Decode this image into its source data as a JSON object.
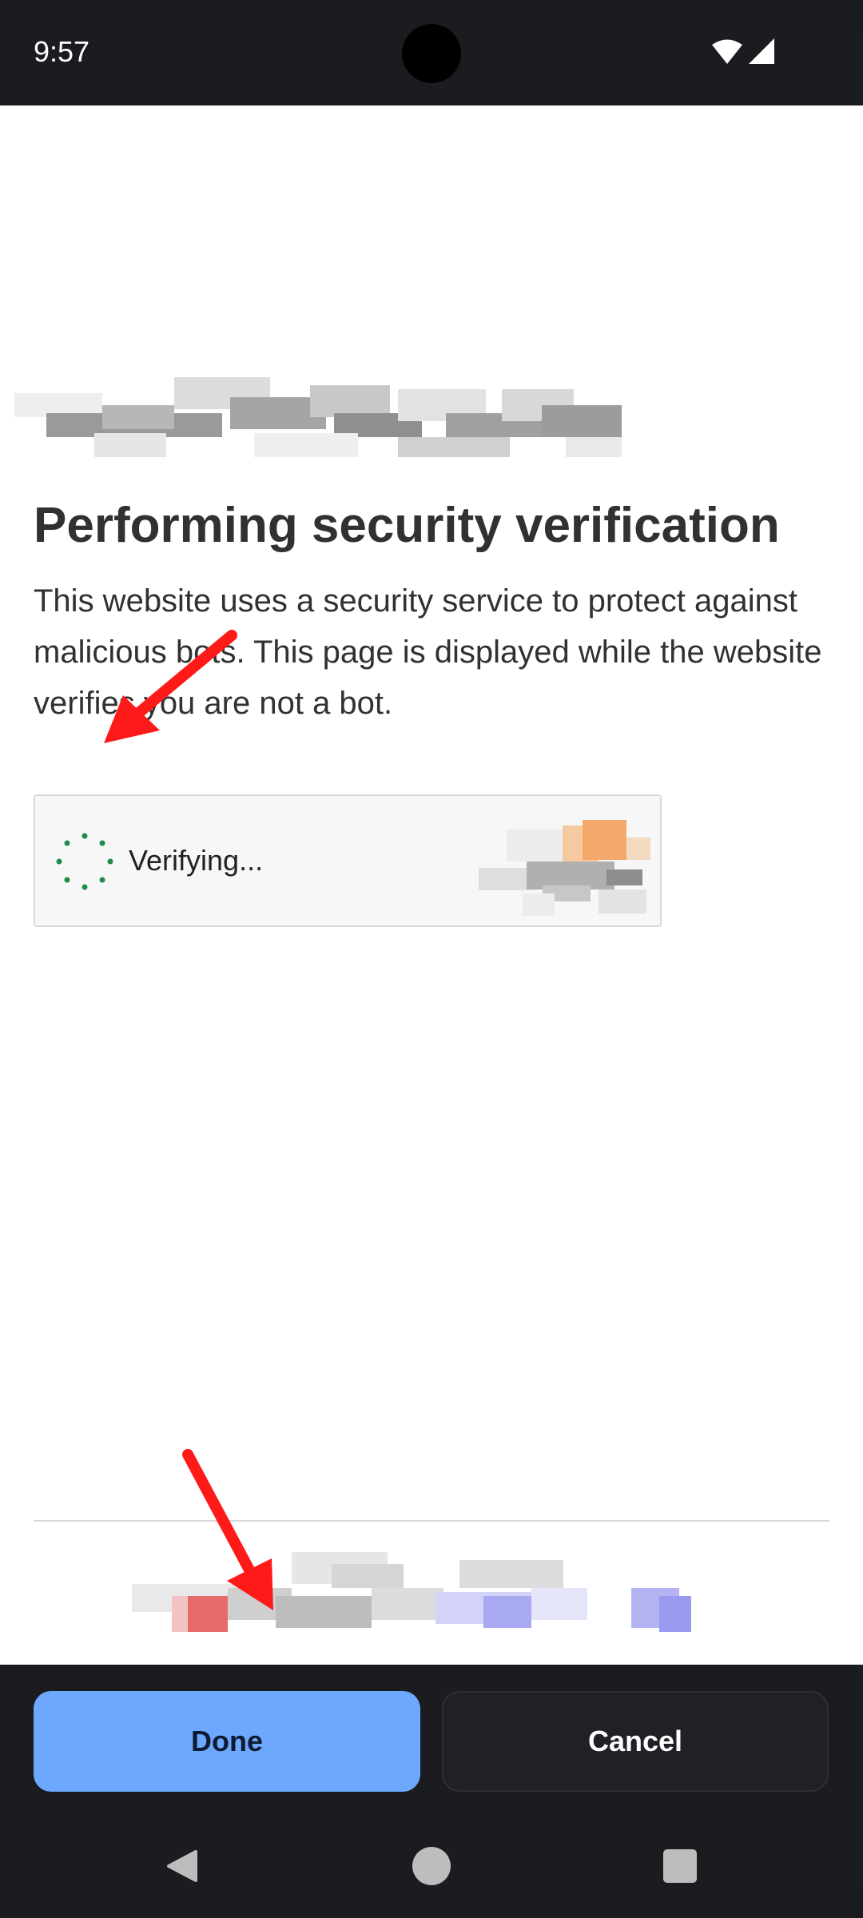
{
  "status_bar": {
    "time": "9:57",
    "icons": [
      "wifi-icon",
      "signal-icon"
    ]
  },
  "page": {
    "title": "Performing security verification",
    "description": "This website uses a security service to protect against malicious bots. This page is displayed while the website verifies you are not a bot.",
    "widget": {
      "status": "Verifying...",
      "icon": "spinner-icon"
    }
  },
  "actions": {
    "done_label": "Done",
    "cancel_label": "Cancel"
  },
  "nav": {
    "icons": [
      "back-icon",
      "home-icon",
      "recents-icon"
    ]
  },
  "colors": {
    "primary_button": "#6ea8fe",
    "spinner": "#1f8b4c",
    "annotation_arrow": "#ff1a1a"
  }
}
